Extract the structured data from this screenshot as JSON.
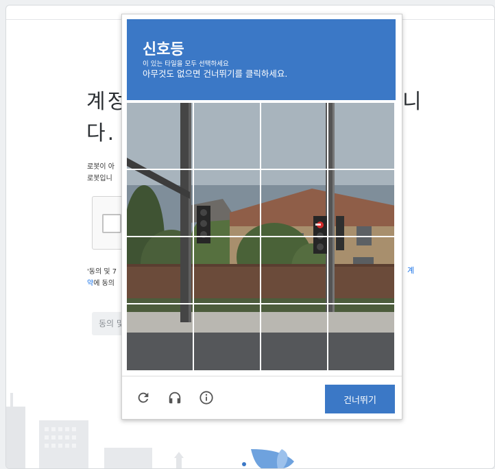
{
  "background": {
    "heading_line1": "계정",
    "heading_line2": "다.",
    "heading_right": "니",
    "text_line1": "로봇이 아",
    "text_line2": "로봇입니",
    "terms_line1": "'동의 및 7",
    "terms_line2_link": "약",
    "terms_line2_rest": "에 동의",
    "terms_right_link": "계",
    "agree_button": "동의 및"
  },
  "captcha": {
    "title": "신호등",
    "subtitle_small": "이 있는 타일을 모두 선택하세요",
    "subtitle": "아무것도 없으면 건너뛰기를 클릭하세요.",
    "skip_label": "건너뛰기",
    "icons": [
      "reload-icon",
      "audio-icon",
      "info-icon"
    ],
    "grid": {
      "rows": 4,
      "cols": 4
    }
  },
  "colors": {
    "accent": "#3b78c6",
    "link": "#1a73e8"
  }
}
